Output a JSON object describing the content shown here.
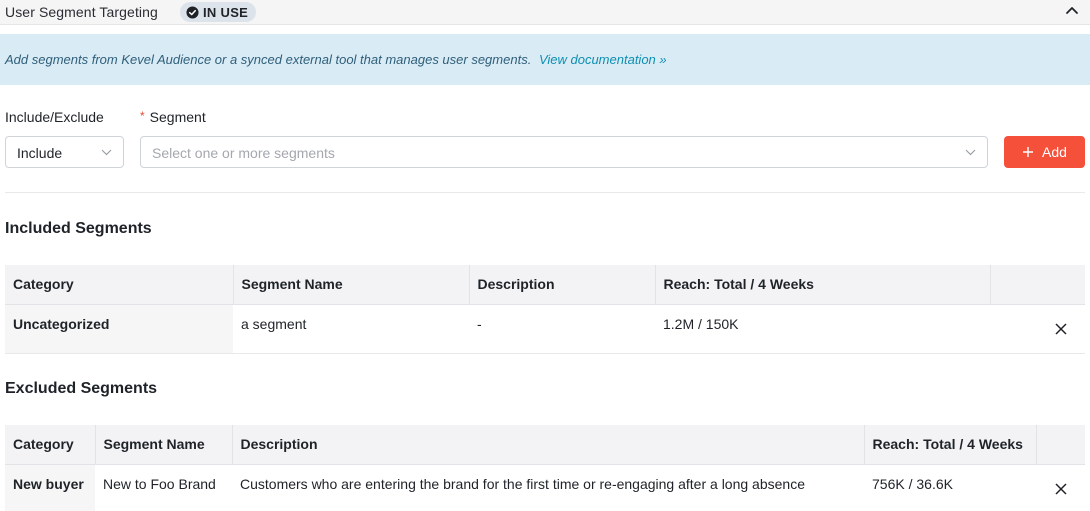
{
  "header": {
    "title": "User Segment Targeting",
    "badge": "IN USE"
  },
  "banner": {
    "text": "Add segments from Kevel Audience or a synced external tool that manages user segments.",
    "link": "View documentation »"
  },
  "form": {
    "include_exclude_label": "Include/Exclude",
    "include_exclude_value": "Include",
    "segment_required_mark": "*",
    "segment_label": "Segment",
    "segment_placeholder": "Select one or more segments",
    "add_button": "Add"
  },
  "included": {
    "title": "Included Segments",
    "headers": [
      "Category",
      "Segment Name",
      "Description",
      "Reach: Total / 4 Weeks"
    ],
    "rows": [
      {
        "category": "Uncategorized",
        "name": "a segment",
        "description": "-",
        "reach": "1.2M / 150K"
      }
    ]
  },
  "excluded": {
    "title": "Excluded Segments",
    "headers": [
      "Category",
      "Segment Name",
      "Description",
      "Reach: Total / 4 Weeks"
    ],
    "rows": [
      {
        "category": "New buyer",
        "name": "New to Foo Brand",
        "description": "Customers who are entering the brand for the first time or re-engaging after a long absence",
        "reach": "756K / 36.6K"
      }
    ]
  },
  "colors": {
    "accent": "#f4503a",
    "banner_bg": "#d9ebf5",
    "link": "#0e8fb0"
  }
}
